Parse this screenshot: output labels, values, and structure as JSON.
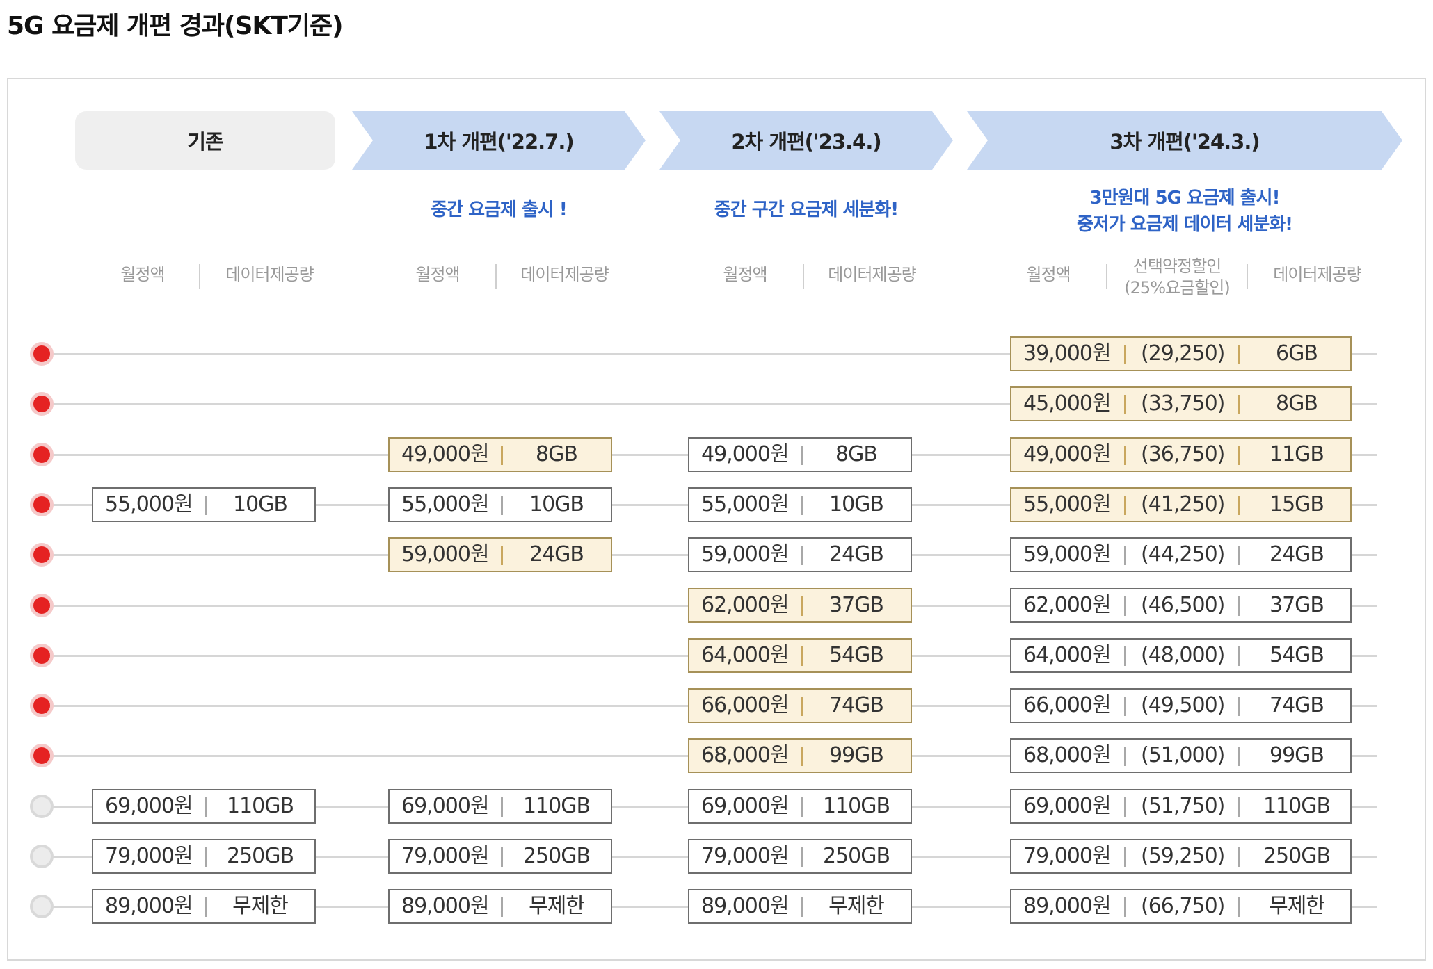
{
  "title": "5G 요금제 개편 경과(SKT기준)",
  "headers": {
    "base": "기존",
    "rev1": "1차 개편('22.7.)",
    "rev2": "2차 개편('23.4.)",
    "rev3": "3차 개편('24.3.)"
  },
  "subheads": {
    "rev1": "중간 요금제 출시 !",
    "rev2": "중간 구간 요금제 세분화!",
    "rev3_line1": "3만원대 5G 요금제 출시!",
    "rev3_line2": "중저가 요금제 데이터 세분화!"
  },
  "column_headers": {
    "monthly": "월정액",
    "data": "데이터제공량",
    "discount_line1": "선택약정할인",
    "discount_line2": "(25%요금할인)"
  },
  "colors": {
    "new_plan_dot": "#e52222",
    "existing_plan_dot": "#ececec",
    "highlight_fill": "#fbf2dd",
    "header_blue": "#c7d8f2",
    "subhead_blue": "#2e63c6"
  },
  "rows": [
    {
      "dot": "red",
      "base": null,
      "rev1": null,
      "rev2": null,
      "rev3": {
        "price": "39,000원",
        "disc": "(29,250)",
        "data": "6GB",
        "new": true
      }
    },
    {
      "dot": "red",
      "base": null,
      "rev1": null,
      "rev2": null,
      "rev3": {
        "price": "45,000원",
        "disc": "(33,750)",
        "data": "8GB",
        "new": true
      }
    },
    {
      "dot": "red",
      "base": null,
      "rev1": {
        "price": "49,000원",
        "data": "8GB",
        "new": true
      },
      "rev2": {
        "price": "49,000원",
        "data": "8GB",
        "new": false
      },
      "rev3": {
        "price": "49,000원",
        "disc": "(36,750)",
        "data": "11GB",
        "new": true
      }
    },
    {
      "dot": "red",
      "base": {
        "price": "55,000원",
        "data": "10GB",
        "new": false
      },
      "rev1": {
        "price": "55,000원",
        "data": "10GB",
        "new": false
      },
      "rev2": {
        "price": "55,000원",
        "data": "10GB",
        "new": false
      },
      "rev3": {
        "price": "55,000원",
        "disc": "(41,250)",
        "data": "15GB",
        "new": true
      }
    },
    {
      "dot": "red",
      "base": null,
      "rev1": {
        "price": "59,000원",
        "data": "24GB",
        "new": true
      },
      "rev2": {
        "price": "59,000원",
        "data": "24GB",
        "new": false
      },
      "rev3": {
        "price": "59,000원",
        "disc": "(44,250)",
        "data": "24GB",
        "new": false
      }
    },
    {
      "dot": "red",
      "base": null,
      "rev1": null,
      "rev2": {
        "price": "62,000원",
        "data": "37GB",
        "new": true
      },
      "rev3": {
        "price": "62,000원",
        "disc": "(46,500)",
        "data": "37GB",
        "new": false
      }
    },
    {
      "dot": "red",
      "base": null,
      "rev1": null,
      "rev2": {
        "price": "64,000원",
        "data": "54GB",
        "new": true
      },
      "rev3": {
        "price": "64,000원",
        "disc": "(48,000)",
        "data": "54GB",
        "new": false
      }
    },
    {
      "dot": "red",
      "base": null,
      "rev1": null,
      "rev2": {
        "price": "66,000원",
        "data": "74GB",
        "new": true
      },
      "rev3": {
        "price": "66,000원",
        "disc": "(49,500)",
        "data": "74GB",
        "new": false
      }
    },
    {
      "dot": "red",
      "base": null,
      "rev1": null,
      "rev2": {
        "price": "68,000원",
        "data": "99GB",
        "new": true
      },
      "rev3": {
        "price": "68,000원",
        "disc": "(51,000)",
        "data": "99GB",
        "new": false
      }
    },
    {
      "dot": "grey",
      "base": {
        "price": "69,000원",
        "data": "110GB",
        "new": false
      },
      "rev1": {
        "price": "69,000원",
        "data": "110GB",
        "new": false
      },
      "rev2": {
        "price": "69,000원",
        "data": "110GB",
        "new": false
      },
      "rev3": {
        "price": "69,000원",
        "disc": "(51,750)",
        "data": "110GB",
        "new": false
      }
    },
    {
      "dot": "grey",
      "base": {
        "price": "79,000원",
        "data": "250GB",
        "new": false
      },
      "rev1": {
        "price": "79,000원",
        "data": "250GB",
        "new": false
      },
      "rev2": {
        "price": "79,000원",
        "data": "250GB",
        "new": false
      },
      "rev3": {
        "price": "79,000원",
        "disc": "(59,250)",
        "data": "250GB",
        "new": false
      }
    },
    {
      "dot": "grey",
      "base": {
        "price": "89,000원",
        "data": "무제한",
        "new": false
      },
      "rev1": {
        "price": "89,000원",
        "data": "무제한",
        "new": false
      },
      "rev2": {
        "price": "89,000원",
        "data": "무제한",
        "new": false
      },
      "rev3": {
        "price": "89,000원",
        "disc": "(66,750)",
        "data": "무제한",
        "new": false
      }
    }
  ]
}
